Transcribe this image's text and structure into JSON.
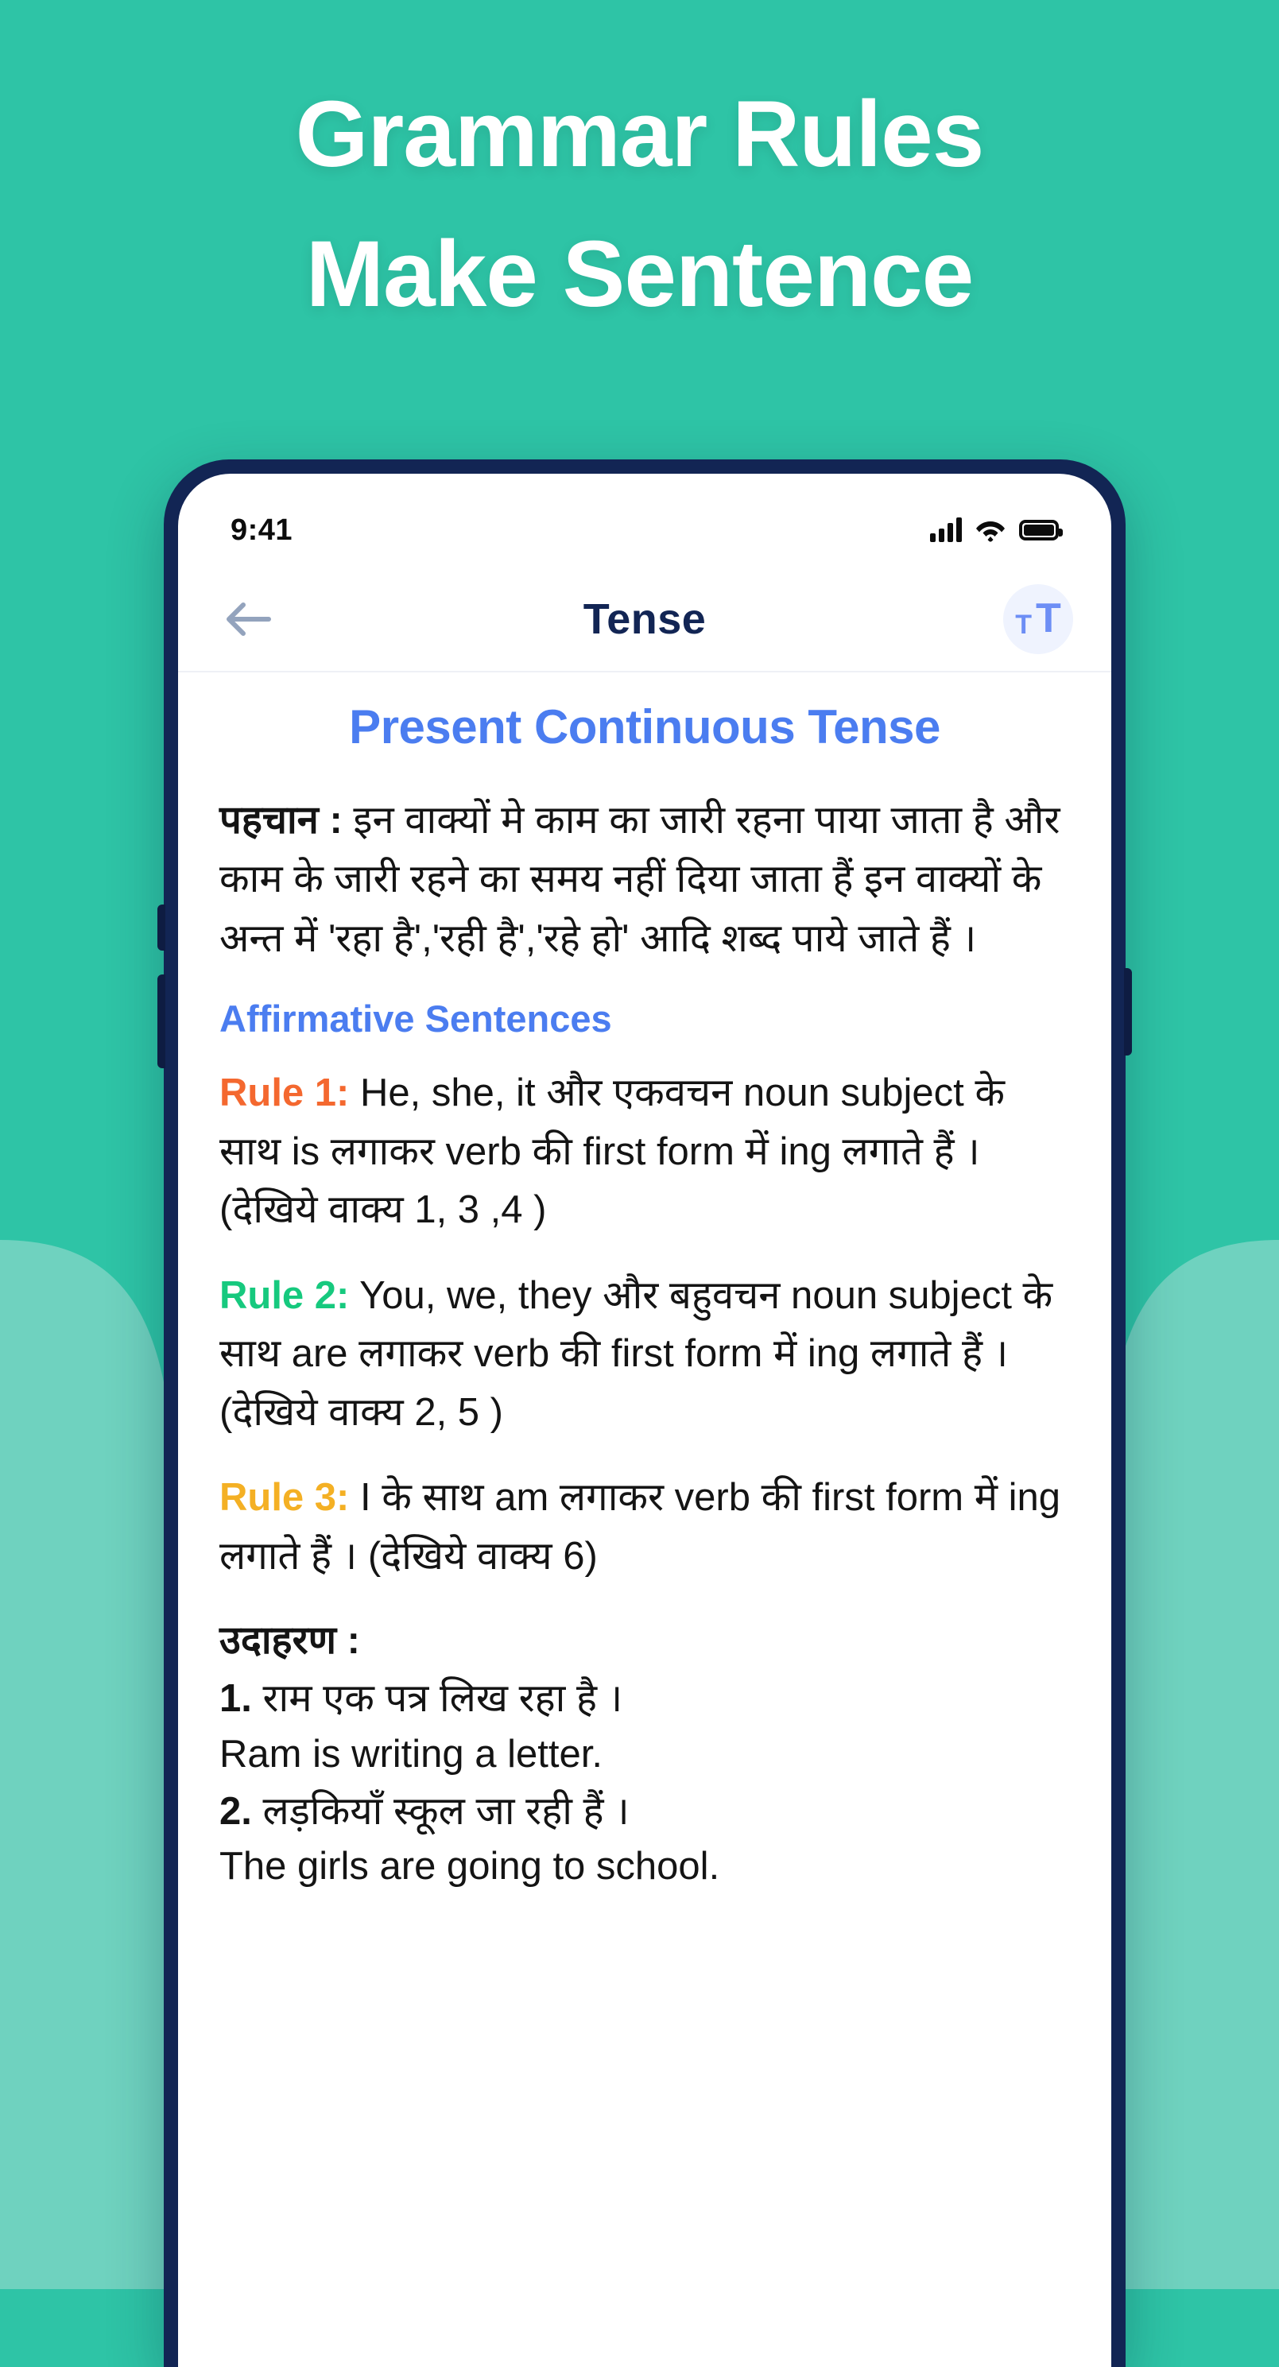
{
  "promo": {
    "line1": "Grammar Rules",
    "line2": "Make Sentence",
    "bg_color_top": "#2ec4a6",
    "bg_color_bottom": "#6fd2bf"
  },
  "phone": {
    "frame_color": "#122554",
    "status_bar": {
      "time": "9:41",
      "signal_icon": "cellular-signal-icon",
      "wifi_icon": "wifi-icon",
      "battery_icon": "battery-icon"
    },
    "app_header": {
      "back_icon": "back-arrow-icon",
      "title": "Tense",
      "font_size_icon_small": "T",
      "font_size_icon_large": "T"
    }
  },
  "content": {
    "lesson_title": "Present Continuous Tense",
    "lesson_title_color": "#4b7df0",
    "identification": {
      "label": "पहचान :",
      "body": " इन वाक्यों मे काम का जारी रहना पाया जाता है और काम के जारी रहने का समय नहीं दिया जाता हैं इन वाक्यों के अन्त में 'रहा है','रही है','रहे हो' आदि शब्द पाये जाते हैं ।"
    },
    "section_heading": "Affirmative Sentences",
    "rules": [
      {
        "label": "Rule 1:",
        "color": "#f4682f",
        "text": " He, she, it और एकवचन noun subject के साथ is लगाकर verb की first form में ing लगाते हैं । (देखिये वाक्य  1, 3 ,4 )"
      },
      {
        "label": "Rule 2:",
        "color": "#16c97e",
        "text": " You, we, they और बहुवचन noun subject के साथ are लगाकर verb की first form में ing लगाते हैं । (देखिये वाक्य  2, 5 )"
      },
      {
        "label": "Rule 3:",
        "color": "#f4b024",
        "text": " I के साथ am लगाकर verb की first form में ing लगाते हैं । (देखिये वाक्य 6)"
      }
    ],
    "examples_heading": "उदाहरण :",
    "examples": [
      {
        "number": "1.",
        "hindi": " राम एक पत्र लिख रहा है ।",
        "english": "Ram is writing a letter."
      },
      {
        "number": "2.",
        "hindi": " लड़कियाँ स्कूल जा  रही हैं ।",
        "english": "The girls are going to school."
      }
    ]
  }
}
